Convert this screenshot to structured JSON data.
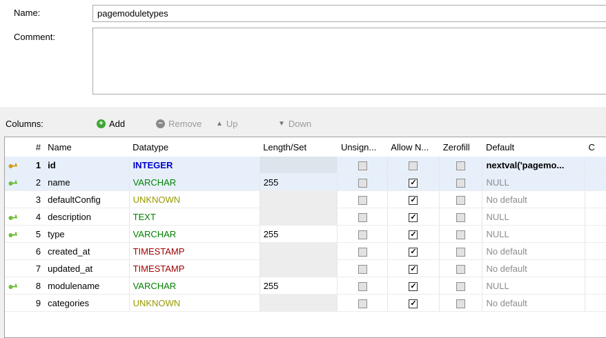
{
  "form": {
    "name_label": "Name:",
    "name_value": "pagemoduletypes",
    "comment_label": "Comment:",
    "comment_value": ""
  },
  "columns_toolbar": {
    "label": "Columns:",
    "add": "Add",
    "remove": "Remove",
    "up": "Up",
    "down": "Down"
  },
  "grid": {
    "headers": [
      "#",
      "Name",
      "Datatype",
      "Length/Set",
      "Unsign...",
      "Allow N...",
      "Zerofill",
      "Default",
      "C"
    ],
    "rows": [
      {
        "num": "1",
        "name": "id",
        "type": "INTEGER",
        "type_color": "#0000cc",
        "length": "",
        "unsigned": false,
        "allow_null": false,
        "zerofill": false,
        "default": "nextval('pagemo...",
        "key": "primary",
        "selected": true
      },
      {
        "num": "2",
        "name": "name",
        "type": "VARCHAR",
        "type_color": "#008000",
        "length": "255",
        "unsigned": false,
        "allow_null": true,
        "zerofill": false,
        "default": "NULL",
        "key": "foreign",
        "selected": true
      },
      {
        "num": "3",
        "name": "defaultConfig",
        "type": "UNKNOWN",
        "type_color": "#999900",
        "length": "",
        "unsigned": false,
        "allow_null": true,
        "zerofill": false,
        "default": "No default",
        "key": "none",
        "selected": false
      },
      {
        "num": "4",
        "name": "description",
        "type": "TEXT",
        "type_color": "#008000",
        "length": "",
        "unsigned": false,
        "allow_null": true,
        "zerofill": false,
        "default": "NULL",
        "key": "foreign",
        "selected": false
      },
      {
        "num": "5",
        "name": "type",
        "type": "VARCHAR",
        "type_color": "#008000",
        "length": "255",
        "unsigned": false,
        "allow_null": true,
        "zerofill": false,
        "default": "NULL",
        "key": "foreign",
        "selected": false
      },
      {
        "num": "6",
        "name": "created_at",
        "type": "TIMESTAMP",
        "type_color": "#a00000",
        "length": "",
        "unsigned": false,
        "allow_null": true,
        "zerofill": false,
        "default": "No default",
        "key": "none",
        "selected": false
      },
      {
        "num": "7",
        "name": "updated_at",
        "type": "TIMESTAMP",
        "type_color": "#a00000",
        "length": "",
        "unsigned": false,
        "allow_null": true,
        "zerofill": false,
        "default": "No default",
        "key": "none",
        "selected": false
      },
      {
        "num": "8",
        "name": "modulename",
        "type": "VARCHAR",
        "type_color": "#008000",
        "length": "255",
        "unsigned": false,
        "allow_null": true,
        "zerofill": false,
        "default": "NULL",
        "key": "foreign",
        "selected": false
      },
      {
        "num": "9",
        "name": "categories",
        "type": "UNKNOWN",
        "type_color": "#999900",
        "length": "",
        "unsigned": false,
        "allow_null": true,
        "zerofill": false,
        "default": "No default",
        "key": "none",
        "selected": false
      }
    ]
  },
  "colors": {
    "primary_key": "#d4a017",
    "foreign_key": "#6fbf3a",
    "add_icon": "#3fa535",
    "selection": "#e7f0fa"
  }
}
